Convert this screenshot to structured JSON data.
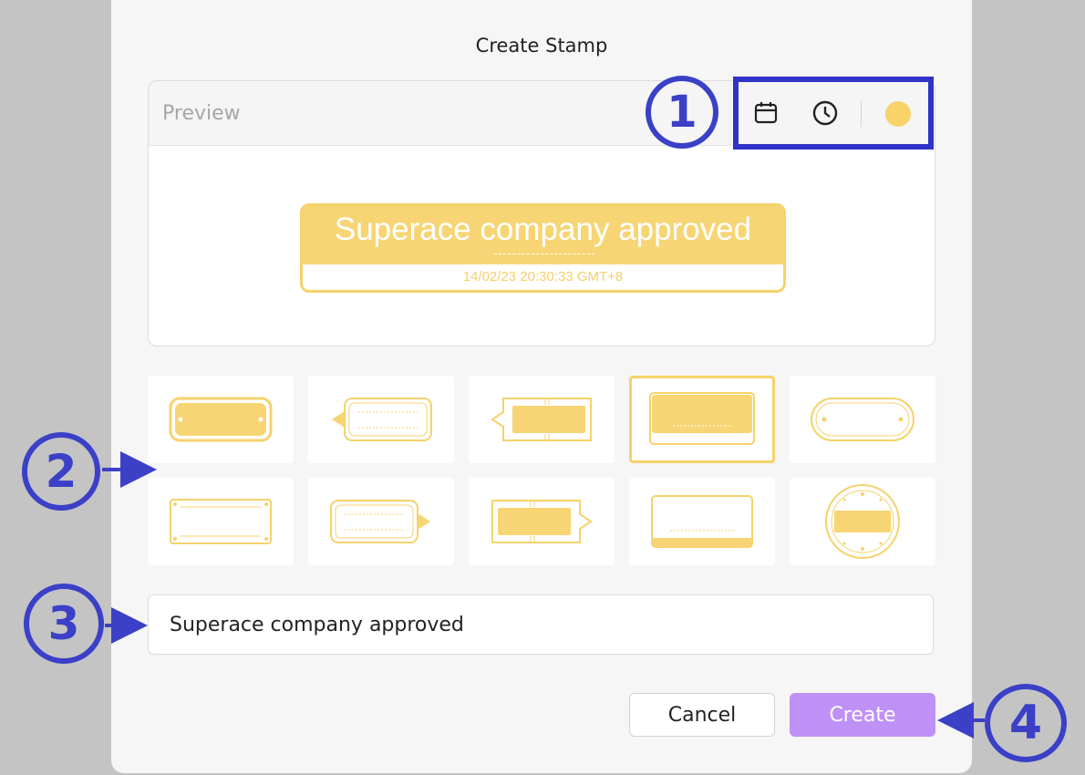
{
  "dialog": {
    "title": "Create Stamp",
    "preview_label": "Preview",
    "tools": {
      "date_icon": "calendar-icon",
      "time_icon": "clock-icon",
      "color": "#f7d36a"
    },
    "stamp_preview": {
      "text": "Superace company approved",
      "date": "14/02/23 20:30:33 GMT+8",
      "color": "#f7d574"
    },
    "templates": [
      "template-1",
      "template-2",
      "template-3",
      "template-4",
      "template-5",
      "template-6",
      "template-7",
      "template-8",
      "template-9",
      "template-10"
    ],
    "selected_template": 4,
    "text_input": {
      "value": "Superace company approved"
    },
    "buttons": {
      "cancel": "Cancel",
      "create": "Create"
    }
  },
  "callouts": {
    "c1": "1",
    "c2": "2",
    "c3": "3",
    "c4": "4"
  },
  "colors": {
    "accent": "#bf90f5",
    "stamp": "#f5d26c",
    "callout": "#3b40c7"
  }
}
